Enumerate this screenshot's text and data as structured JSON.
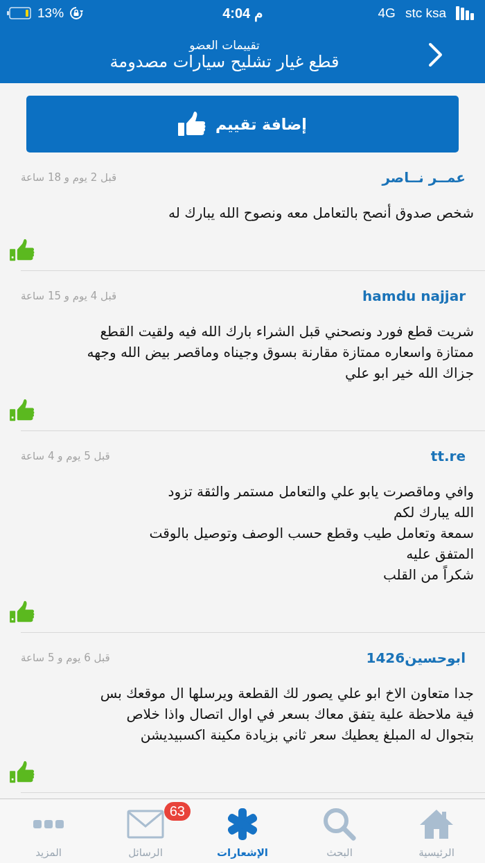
{
  "status_bar": {
    "carrier": "stc ksa",
    "network": "4G",
    "time": "4:04 م",
    "battery": "13%"
  },
  "header": {
    "subtitle": "تقييمات العضو",
    "title": "قطع غيار تشليح سيارات مصدومة"
  },
  "add_button": {
    "label": "إضافة تقييم"
  },
  "reviews": [
    {
      "author": "عمــر نــاصر",
      "time": "قبل 2 يوم و 18 ساعة",
      "lines": [
        "شخص صدوق أنصح بالتعامل معه ونصوح الله يبارك له"
      ]
    },
    {
      "author": "hamdu najjar",
      "time": "قبل 4 يوم و 15 ساعة",
      "lines": [
        "شريت قطع فورد ونصحني قبل الشراء بارك الله فيه ولقيت القطع",
        "ممتازة واسعاره ممتازة مقارنة بسوق وجيناه وماقصر بيض الله وجهه",
        "جزاك الله خير ابو علي"
      ]
    },
    {
      "author": "tt.re",
      "time": "قبل 5 يوم و 4 ساعة",
      "lines": [
        "وافي وماقصرت يابو علي والتعامل مستمر والثقة تزود",
        "الله يبارك لكم",
        "سمعة وتعامل طيب وقطع حسب الوصف وتوصيل بالوقت",
        "المتفق عليه",
        "شكراً من القلب"
      ]
    },
    {
      "author": "ابوحسين1426",
      "time": "قبل 6 يوم و 5 ساعة",
      "lines": [
        "جدا متعاون الاخ ابو علي يصور لك القطعة ويرسلها ال موقعك بس",
        "فية ملاحظة علية يتفق معاك بسعر في اوال اتصال واذا  خلاص",
        "بتجوال له المبلغ يعطيك سعر ثاني بزيادة مكينة اكسبيديشن"
      ]
    }
  ],
  "tab_bar": [
    {
      "kind": "home",
      "label": "الرئيسية",
      "selected": false
    },
    {
      "kind": "search",
      "label": "البحث",
      "selected": false
    },
    {
      "kind": "alerts",
      "label": "الإشعارات",
      "selected": true
    },
    {
      "kind": "messages",
      "label": "الرسائل",
      "selected": false,
      "badge": "63"
    },
    {
      "kind": "more",
      "label": "المزيد",
      "selected": false
    }
  ]
}
